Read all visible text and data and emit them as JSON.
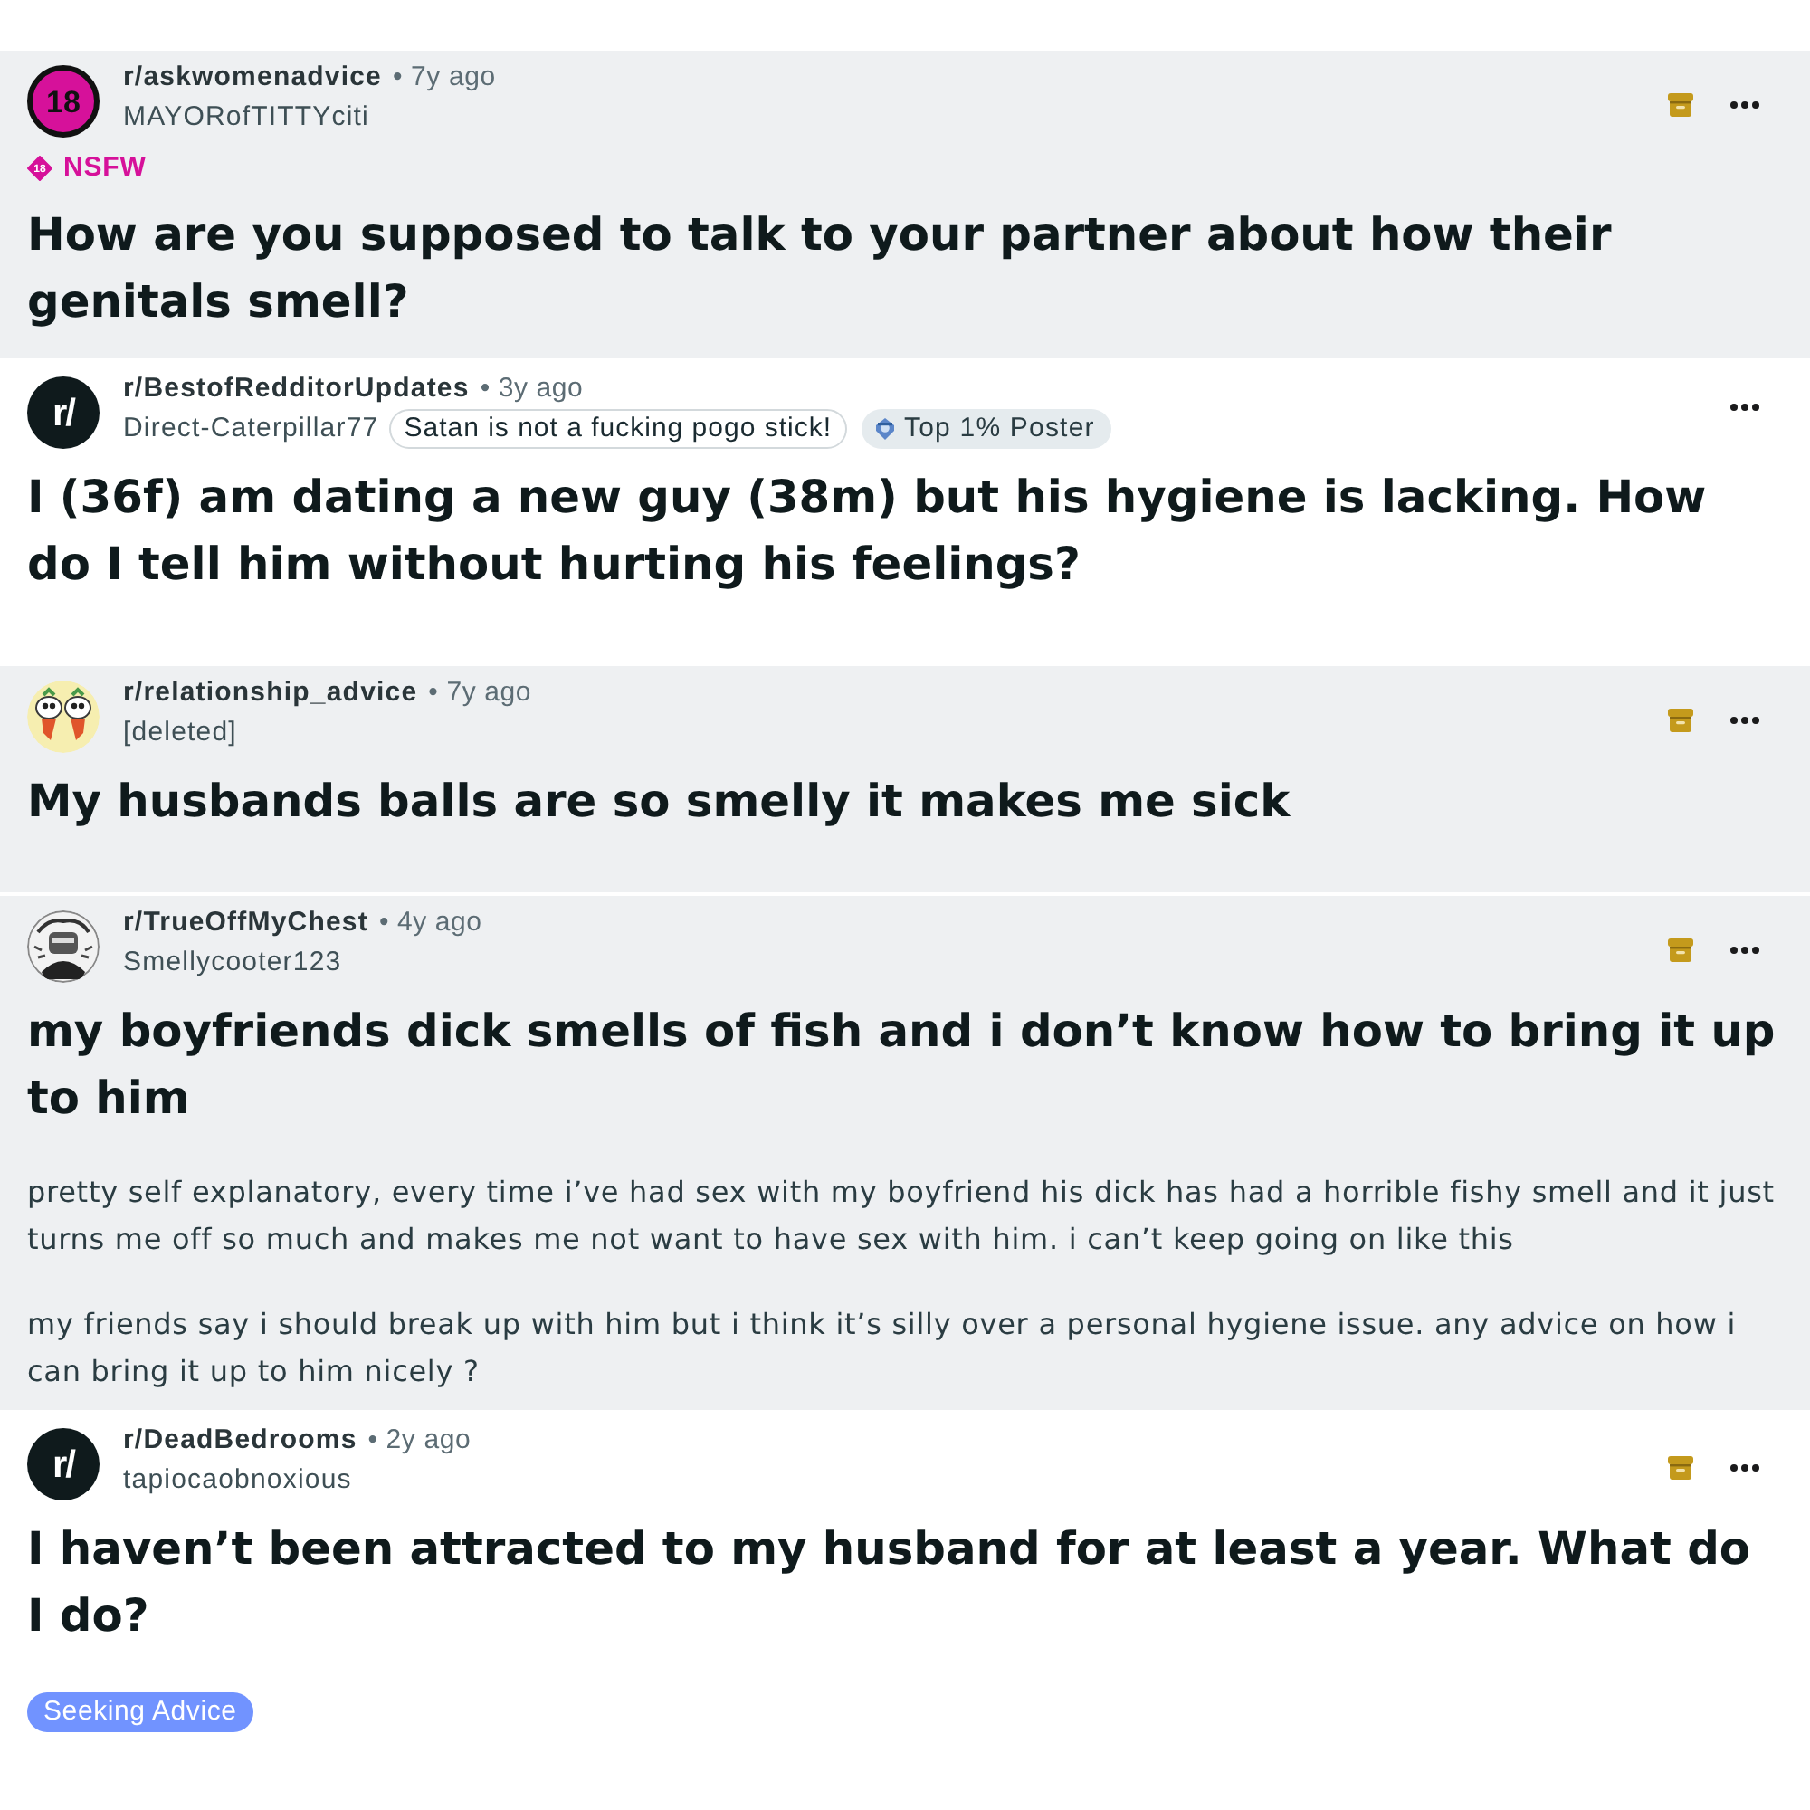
{
  "posts": [
    {
      "highlighted": true,
      "avatar": {
        "kind": "nsfw",
        "text": "18"
      },
      "subreddit": "r/askwomenadvice",
      "meta": "• 7y ago",
      "author": "MAYORofTITTYciti",
      "archived": true,
      "tags": [
        {
          "kind": "nsfw",
          "icon_text": "18",
          "label": "NSFW"
        }
      ],
      "title": "How are you supposed to talk to your partner about how their genitals smell?"
    },
    {
      "highlighted": false,
      "avatar": {
        "kind": "logo",
        "text": "r/"
      },
      "subreddit": "r/BestofRedditorUpdates",
      "meta": "• 3y ago",
      "author": "Direct-Caterpillar77",
      "author_badges": [
        {
          "kind": "flair",
          "label": "Satan is not a fucking pogo stick!"
        },
        {
          "kind": "achievement",
          "label": "Top 1% Poster"
        }
      ],
      "archived": false,
      "title": "I (36f) am dating a new guy (38m) but his hygiene is lacking. How do I tell him without hurting his feelings?"
    },
    {
      "highlighted": true,
      "avatar": {
        "kind": "cartoon"
      },
      "subreddit": "r/relationship_advice",
      "meta": "• 7y ago",
      "author": "[deleted]",
      "archived": true,
      "title": "My husbands balls are so smelly it makes me sick"
    },
    {
      "highlighted": true,
      "avatar": {
        "kind": "sketch"
      },
      "subreddit": "r/TrueOffMyChest",
      "meta": "• 4y ago",
      "author": "Smellycooter123",
      "archived": true,
      "title": "my boyfriends dick smells of fish and i don’t know how to bring it up to him",
      "body": [
        "pretty self explanatory, every time i’ve had sex with my boyfriend his dick has had a horrible fishy smell and it just turns me off so much and makes me not want to have sex with him. i can’t keep going on like this",
        "my friends say i should break up with him but i think it’s silly over a personal hygiene issue. any advice on how i can bring it up to him nicely ?"
      ]
    },
    {
      "highlighted": false,
      "avatar": {
        "kind": "logo",
        "text": "r/"
      },
      "subreddit": "r/DeadBedrooms",
      "meta": "• 2y ago",
      "author": "tapiocaobnoxious",
      "archived": true,
      "title": "I haven’t been attracted to my husband for at least a year. What do I do?",
      "post_flair": {
        "label": "Seeking Advice"
      }
    }
  ]
}
